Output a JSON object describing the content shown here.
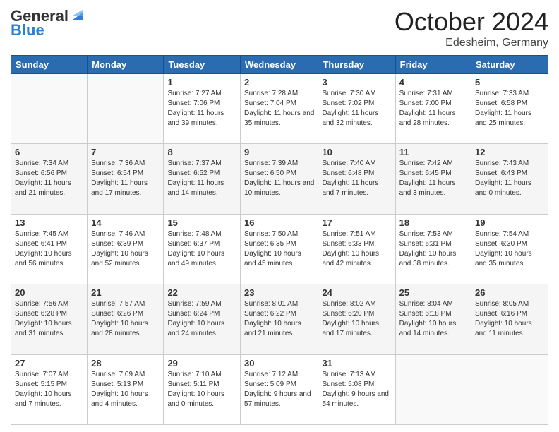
{
  "logo": {
    "line1": "General",
    "line2": "Blue"
  },
  "title": "October 2024",
  "subtitle": "Edesheim, Germany",
  "header": {
    "days": [
      "Sunday",
      "Monday",
      "Tuesday",
      "Wednesday",
      "Thursday",
      "Friday",
      "Saturday"
    ]
  },
  "weeks": [
    [
      {
        "day": "",
        "info": ""
      },
      {
        "day": "",
        "info": ""
      },
      {
        "day": "1",
        "info": "Sunrise: 7:27 AM\nSunset: 7:06 PM\nDaylight: 11 hours and 39 minutes."
      },
      {
        "day": "2",
        "info": "Sunrise: 7:28 AM\nSunset: 7:04 PM\nDaylight: 11 hours and 35 minutes."
      },
      {
        "day": "3",
        "info": "Sunrise: 7:30 AM\nSunset: 7:02 PM\nDaylight: 11 hours and 32 minutes."
      },
      {
        "day": "4",
        "info": "Sunrise: 7:31 AM\nSunset: 7:00 PM\nDaylight: 11 hours and 28 minutes."
      },
      {
        "day": "5",
        "info": "Sunrise: 7:33 AM\nSunset: 6:58 PM\nDaylight: 11 hours and 25 minutes."
      }
    ],
    [
      {
        "day": "6",
        "info": "Sunrise: 7:34 AM\nSunset: 6:56 PM\nDaylight: 11 hours and 21 minutes."
      },
      {
        "day": "7",
        "info": "Sunrise: 7:36 AM\nSunset: 6:54 PM\nDaylight: 11 hours and 17 minutes."
      },
      {
        "day": "8",
        "info": "Sunrise: 7:37 AM\nSunset: 6:52 PM\nDaylight: 11 hours and 14 minutes."
      },
      {
        "day": "9",
        "info": "Sunrise: 7:39 AM\nSunset: 6:50 PM\nDaylight: 11 hours and 10 minutes."
      },
      {
        "day": "10",
        "info": "Sunrise: 7:40 AM\nSunset: 6:48 PM\nDaylight: 11 hours and 7 minutes."
      },
      {
        "day": "11",
        "info": "Sunrise: 7:42 AM\nSunset: 6:45 PM\nDaylight: 11 hours and 3 minutes."
      },
      {
        "day": "12",
        "info": "Sunrise: 7:43 AM\nSunset: 6:43 PM\nDaylight: 11 hours and 0 minutes."
      }
    ],
    [
      {
        "day": "13",
        "info": "Sunrise: 7:45 AM\nSunset: 6:41 PM\nDaylight: 10 hours and 56 minutes."
      },
      {
        "day": "14",
        "info": "Sunrise: 7:46 AM\nSunset: 6:39 PM\nDaylight: 10 hours and 52 minutes."
      },
      {
        "day": "15",
        "info": "Sunrise: 7:48 AM\nSunset: 6:37 PM\nDaylight: 10 hours and 49 minutes."
      },
      {
        "day": "16",
        "info": "Sunrise: 7:50 AM\nSunset: 6:35 PM\nDaylight: 10 hours and 45 minutes."
      },
      {
        "day": "17",
        "info": "Sunrise: 7:51 AM\nSunset: 6:33 PM\nDaylight: 10 hours and 42 minutes."
      },
      {
        "day": "18",
        "info": "Sunrise: 7:53 AM\nSunset: 6:31 PM\nDaylight: 10 hours and 38 minutes."
      },
      {
        "day": "19",
        "info": "Sunrise: 7:54 AM\nSunset: 6:30 PM\nDaylight: 10 hours and 35 minutes."
      }
    ],
    [
      {
        "day": "20",
        "info": "Sunrise: 7:56 AM\nSunset: 6:28 PM\nDaylight: 10 hours and 31 minutes."
      },
      {
        "day": "21",
        "info": "Sunrise: 7:57 AM\nSunset: 6:26 PM\nDaylight: 10 hours and 28 minutes."
      },
      {
        "day": "22",
        "info": "Sunrise: 7:59 AM\nSunset: 6:24 PM\nDaylight: 10 hours and 24 minutes."
      },
      {
        "day": "23",
        "info": "Sunrise: 8:01 AM\nSunset: 6:22 PM\nDaylight: 10 hours and 21 minutes."
      },
      {
        "day": "24",
        "info": "Sunrise: 8:02 AM\nSunset: 6:20 PM\nDaylight: 10 hours and 17 minutes."
      },
      {
        "day": "25",
        "info": "Sunrise: 8:04 AM\nSunset: 6:18 PM\nDaylight: 10 hours and 14 minutes."
      },
      {
        "day": "26",
        "info": "Sunrise: 8:05 AM\nSunset: 6:16 PM\nDaylight: 10 hours and 11 minutes."
      }
    ],
    [
      {
        "day": "27",
        "info": "Sunrise: 7:07 AM\nSunset: 5:15 PM\nDaylight: 10 hours and 7 minutes."
      },
      {
        "day": "28",
        "info": "Sunrise: 7:09 AM\nSunset: 5:13 PM\nDaylight: 10 hours and 4 minutes."
      },
      {
        "day": "29",
        "info": "Sunrise: 7:10 AM\nSunset: 5:11 PM\nDaylight: 10 hours and 0 minutes."
      },
      {
        "day": "30",
        "info": "Sunrise: 7:12 AM\nSunset: 5:09 PM\nDaylight: 9 hours and 57 minutes."
      },
      {
        "day": "31",
        "info": "Sunrise: 7:13 AM\nSunset: 5:08 PM\nDaylight: 9 hours and 54 minutes."
      },
      {
        "day": "",
        "info": ""
      },
      {
        "day": "",
        "info": ""
      }
    ]
  ]
}
